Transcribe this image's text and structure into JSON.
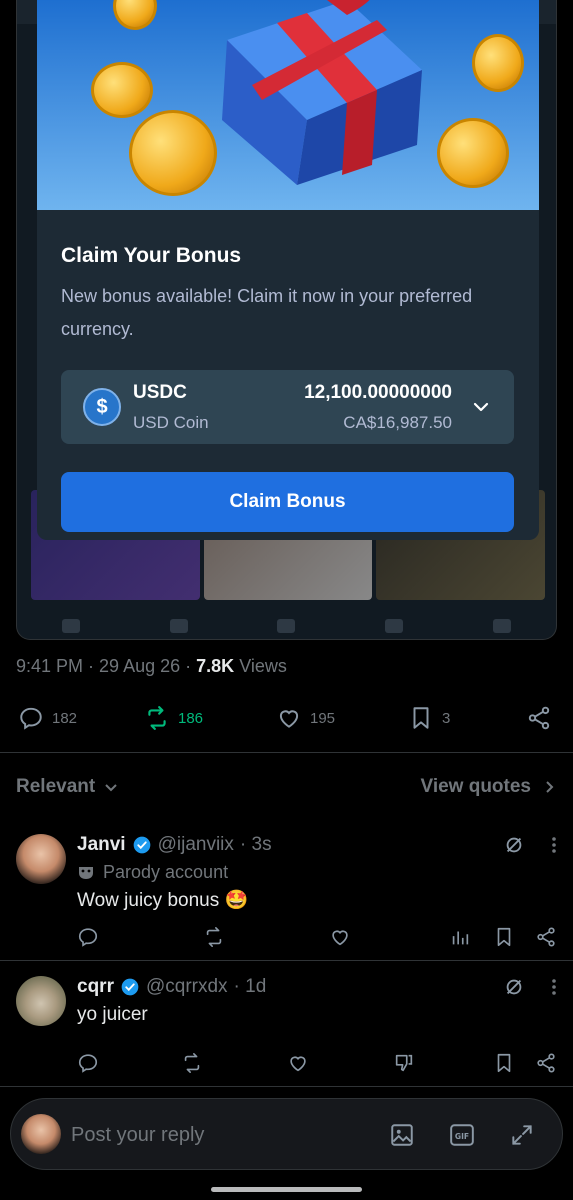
{
  "modal": {
    "title": "Claim Your Bonus",
    "description": "New bonus available! Claim it now in your preferred currency.",
    "currency": {
      "code": "USDC",
      "name": "USD Coin",
      "amount": "12,100.00000000",
      "fiat": "CA$16,987.50",
      "icon": "usdc-coin-icon",
      "icon_glyph": "$"
    },
    "claim_label": "Claim Bonus",
    "accent_color": "#1f6fe0"
  },
  "tweet": {
    "time": "9:41 PM",
    "date": "29 Aug 26",
    "views_count": "7.8K",
    "views_label": "Views",
    "replies": "182",
    "reposts": "186",
    "likes": "195",
    "bookmarks": "3"
  },
  "sort": {
    "label": "Relevant",
    "view_quotes": "View quotes"
  },
  "replies": [
    {
      "name": "Janvi",
      "handle": "@ijanviix",
      "time": "· 3s",
      "badge": "Parody account",
      "text": "Wow juicy bonus 🤩"
    },
    {
      "name": "cqrr",
      "handle": "@cqrrxdx",
      "time": "· 1d",
      "text": "yo juicer"
    }
  ],
  "composer": {
    "placeholder": "Post your reply"
  },
  "colors": {
    "repost_active": "#00ba7c",
    "verified": "#1d9bf0",
    "muted": "#71767b"
  }
}
